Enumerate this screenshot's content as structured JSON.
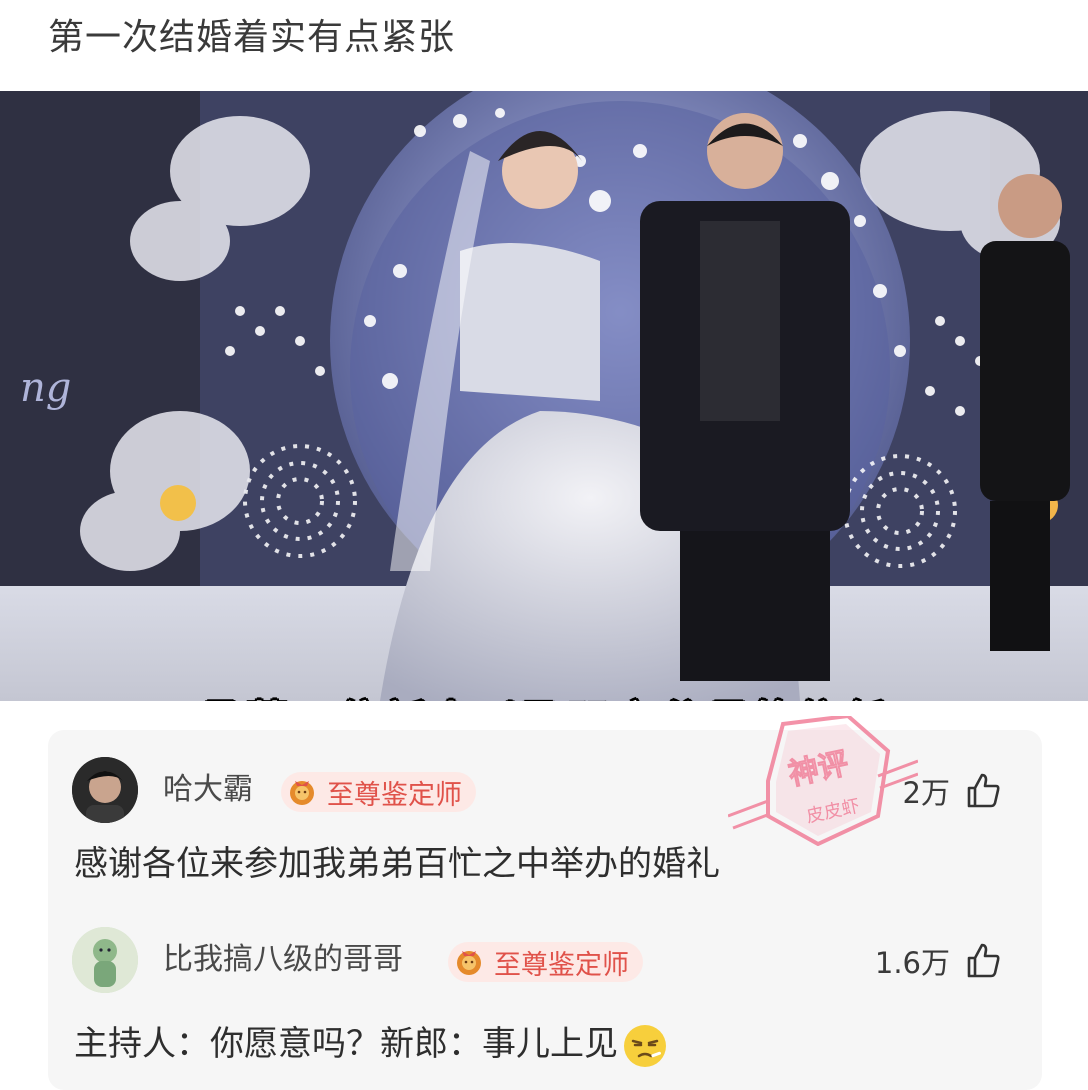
{
  "post": {
    "title": "第一次结婚着实有点紧张"
  },
  "video": {
    "subtitle": "承蒙二位新人以及双方父母的信任",
    "backdrop_letters": "ng"
  },
  "stamp": {
    "top_text": "神评",
    "bottom_text": "皮皮虾"
  },
  "comments": [
    {
      "username": "哈大霸",
      "badge": "至尊鉴定师",
      "likes": "2万",
      "text": "感谢各位来参加我弟弟百忙之中举办的婚礼"
    },
    {
      "username": "比我搞八级的哥哥",
      "badge": "至尊鉴定师",
      "likes": "1.6万",
      "text": "主持人：你愿意吗？新郎：事儿上见"
    }
  ],
  "colors": {
    "badge_text": "#e0524a",
    "badge_bg": "#fde9e6",
    "stamp": "#f06e8c",
    "comment_bg": "#f6f6f6"
  }
}
